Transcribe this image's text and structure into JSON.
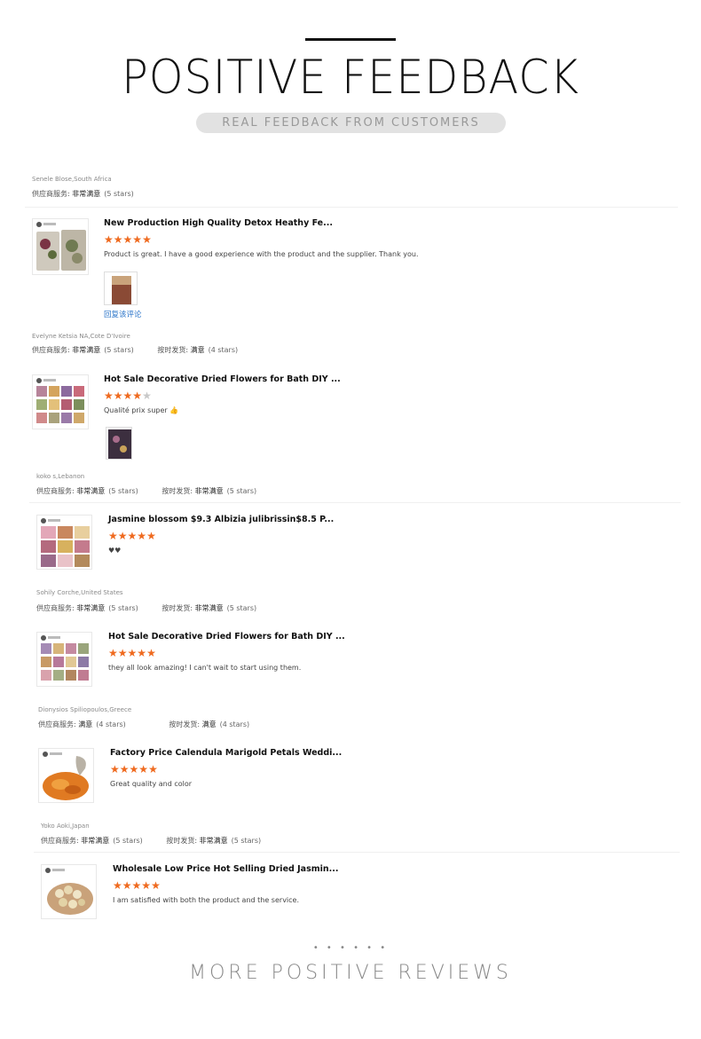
{
  "header": {
    "title": "POSITIVE FEEDBACK",
    "subtitle": "REAL FEEDBACK FROM CUSTOMERS"
  },
  "colors": {
    "star": "#ef6a1f",
    "star_empty": "#c8c8c8",
    "link": "#2a74c9"
  },
  "reviews": [
    {
      "reviewer": "Senele Blose,South Africa",
      "ratings": [
        {
          "label": "供应商服务:",
          "value": "非常满意",
          "stars": "(5 stars)"
        }
      ],
      "product_title": "New Production High Quality Detox Heathy Fe...",
      "star_rating": 5,
      "comment": "Product is great. I have a good experience with the product and the supplier. Thank you.",
      "has_photo": true,
      "reply_link": "回复该评论"
    },
    {
      "reviewer": "Evelyne Ketsia NA,Cote D'Ivoire",
      "ratings": [
        {
          "label": "供应商服务:",
          "value": "非常满意",
          "stars": "(5 stars)"
        },
        {
          "label": "按时发货:",
          "value": "满意",
          "stars": "(4 stars)"
        }
      ],
      "product_title": "Hot Sale Decorative Dried Flowers for Bath DIY ...",
      "star_rating": 4,
      "comment": "Qualité prix super 👍",
      "has_photo": true
    },
    {
      "reviewer": "koko s,Lebanon",
      "ratings": [
        {
          "label": "供应商服务:",
          "value": "非常满意",
          "stars": "(5 stars)"
        },
        {
          "label": "按时发货:",
          "value": "非常满意",
          "stars": "(5 stars)"
        }
      ],
      "product_title": "Jasmine blossom $9.3 Albizia julibrissin$8.5 P...",
      "star_rating": 5,
      "comment": "♥♥"
    },
    {
      "reviewer": "Sohily Corche,United States",
      "ratings": [
        {
          "label": "供应商服务:",
          "value": "非常满意",
          "stars": "(5 stars)"
        },
        {
          "label": "按时发货:",
          "value": "非常满意",
          "stars": "(5 stars)"
        }
      ],
      "product_title": "Hot Sale Decorative Dried Flowers for Bath DIY ...",
      "star_rating": 5,
      "comment": "they all look amazing! I can't wait to start using them."
    },
    {
      "reviewer": "Dionysios Spiliopoulos,Greece",
      "ratings": [
        {
          "label": "供应商服务:",
          "value": "满意",
          "stars": "(4 stars)"
        },
        {
          "label": "按时发货:",
          "value": "满意",
          "stars": "(4 stars)"
        }
      ],
      "product_title": "Factory Price Calendula Marigold Petals Weddi...",
      "star_rating": 5,
      "comment": "Great quality and color"
    },
    {
      "reviewer": "Yoko Aoki,Japan",
      "ratings": [
        {
          "label": "供应商服务:",
          "value": "非常满意",
          "stars": "(5 stars)"
        },
        {
          "label": "按时发货:",
          "value": "非常满意",
          "stars": "(5 stars)"
        }
      ],
      "product_title": "Wholesale Low Price Hot Selling Dried Jasmin...",
      "star_rating": 5,
      "comment": "I am satisfied with both the product and the service."
    }
  ],
  "footer": {
    "dots": "• • • • • •",
    "more_label": "MORE POSITIVE REVIEWS"
  }
}
